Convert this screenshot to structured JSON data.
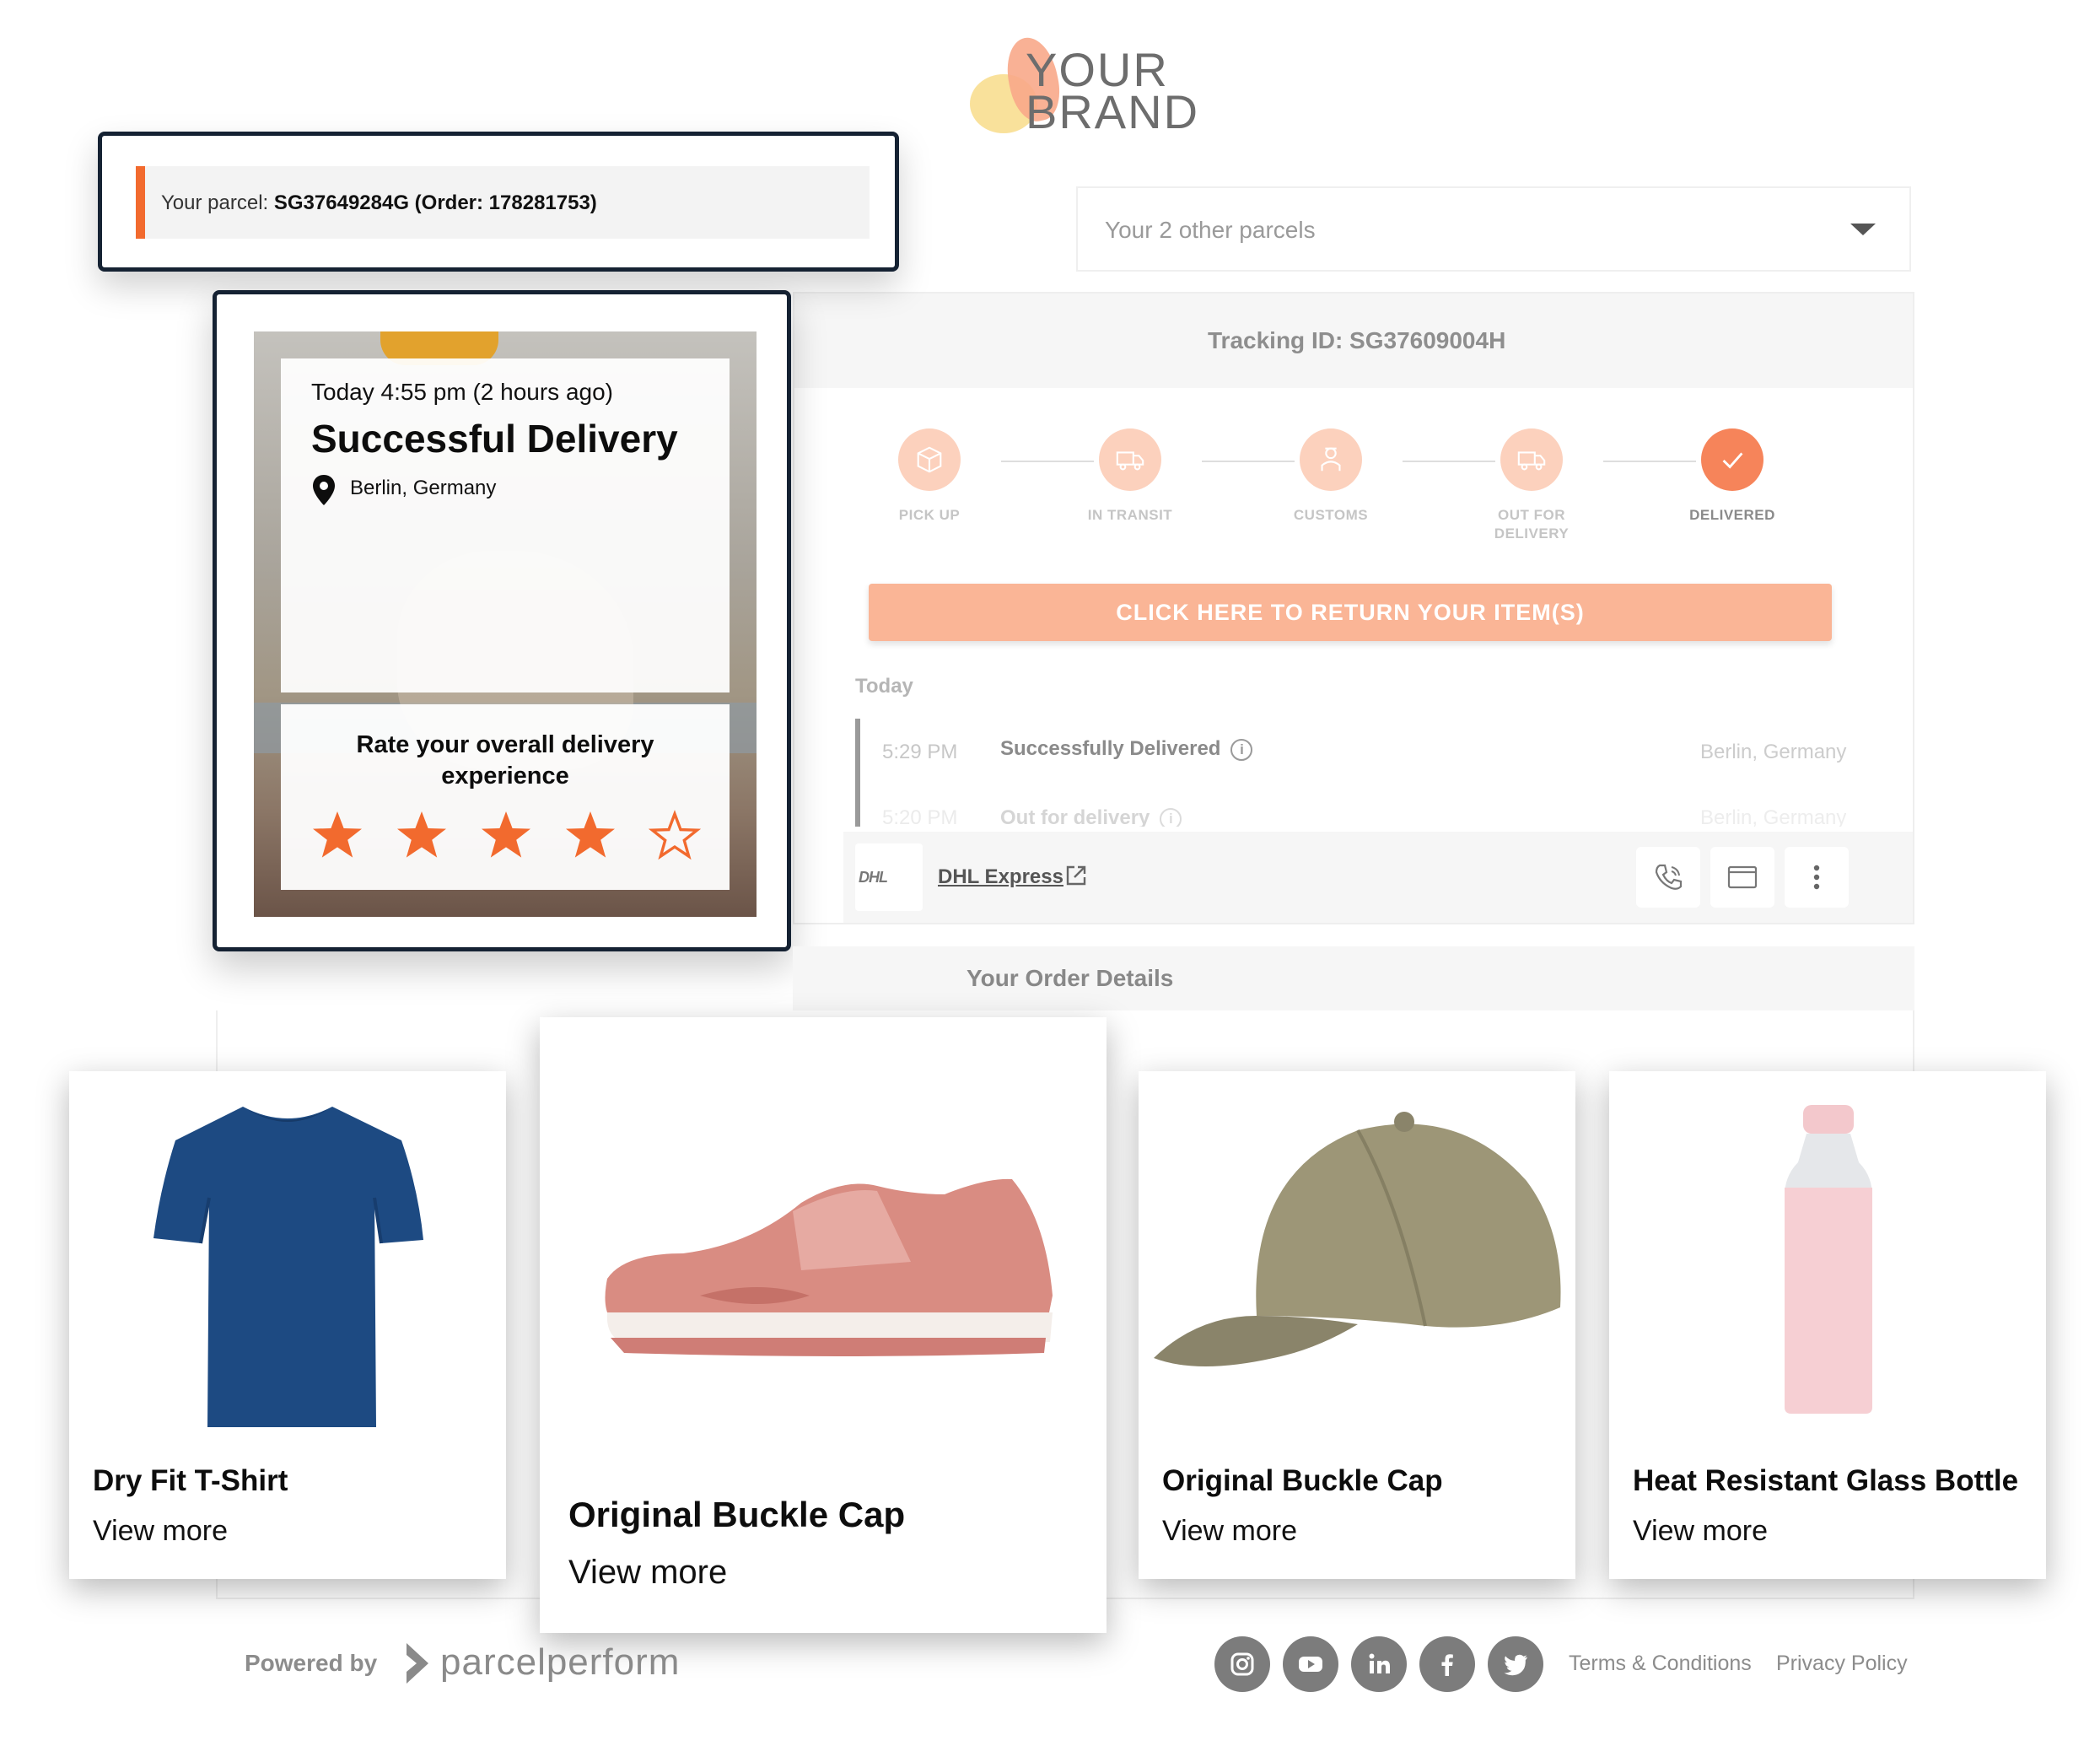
{
  "brand": {
    "line1": "YOUR",
    "line2": "BRAND"
  },
  "parcel_selector": {
    "prefix": "Your parcel: ",
    "value": "SG37649284G (Order: 178281753)"
  },
  "other_parcels": {
    "placeholder": "Your 2 other parcels"
  },
  "tracking": {
    "title": "Tracking ID: SG37609004H",
    "steps": [
      {
        "label": "PICK UP",
        "icon": "package-icon",
        "active": false
      },
      {
        "label": "IN TRANSIT",
        "icon": "truck-icon",
        "active": false
      },
      {
        "label": "CUSTOMS",
        "icon": "customs-officer-icon",
        "active": false
      },
      {
        "label": "OUT FOR",
        "label2": "DELIVERY",
        "icon": "delivery-truck-icon",
        "active": false
      },
      {
        "label": "DELIVERED",
        "icon": "check-icon",
        "active": true
      }
    ],
    "return_button": "CLICK HERE TO RETURN YOUR ITEM(S)",
    "day_label": "Today",
    "events": [
      {
        "time": "5:29 PM",
        "title": "Successfully Delivered",
        "location": "Berlin, Germany"
      },
      {
        "time": "5:20 PM",
        "title": "Out for delivery",
        "location": "Berlin, Germany"
      }
    ],
    "carrier": {
      "logo_text": "DHL",
      "name": "DHL Express"
    }
  },
  "delivery_card": {
    "time": "Today 4:55 pm (2 hours ago)",
    "title": "Successful Delivery",
    "location": "Berlin, Germany",
    "rate_prompt": "Rate your overall delivery experience",
    "rating": 4,
    "max_rating": 5,
    "star_color": "#f26a2e"
  },
  "order": {
    "title": "Your Order Details",
    "products": [
      {
        "name": "Dry Fit T-Shirt",
        "link": "View more"
      },
      {
        "name": "Original Buckle Cap",
        "link": "View more"
      },
      {
        "name": "Original Buckle Cap",
        "link": "View more"
      },
      {
        "name": "Heat Resistant Glass Bottle",
        "link": "View more"
      }
    ]
  },
  "footer": {
    "powered_by": "Powered by",
    "provider": "parcelperform",
    "socials": [
      "instagram-icon",
      "youtube-icon",
      "linkedin-icon",
      "facebook-icon",
      "twitter-icon"
    ],
    "terms": "Terms & Conditions",
    "privacy": "Privacy Policy"
  },
  "colors": {
    "accent": "#f26a2e",
    "accent_light": "#fcd1bd",
    "button": "#fab596",
    "frame": "#152233"
  }
}
